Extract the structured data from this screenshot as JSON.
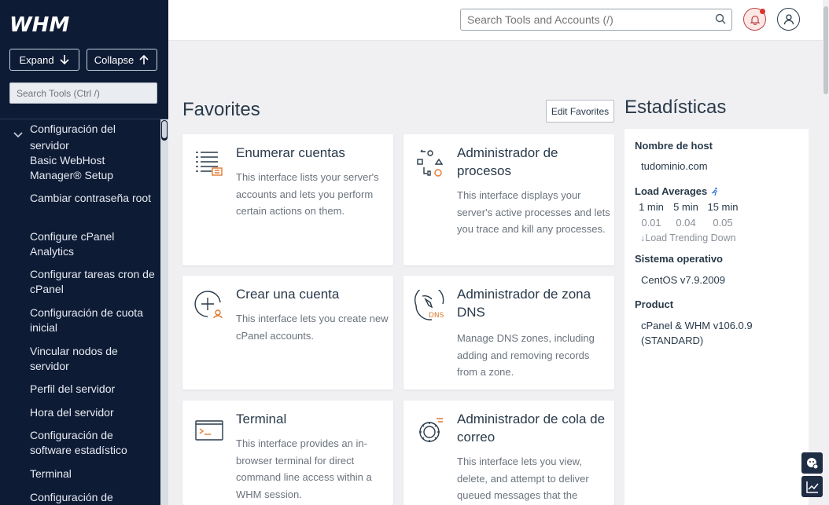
{
  "sidebar": {
    "logo_text": "WHM",
    "expand_label": "Expand",
    "collapse_label": "Collapse",
    "search_placeholder": "Search Tools (Ctrl /)",
    "section_title": "Configuración del servidor",
    "items": [
      {
        "label": "Basic WebHost Manager® Setup"
      },
      {
        "label": "Cambiar contraseña root"
      },
      {
        "label": "Configure cPanel Analytics"
      },
      {
        "label": "Configurar tareas cron de cPanel"
      },
      {
        "label": "Configuración de cuota inicial"
      },
      {
        "label": "Vincular nodos de servidor"
      },
      {
        "label": "Perfil del servidor"
      },
      {
        "label": "Hora del servidor"
      },
      {
        "label": "Configuración de software estadístico"
      },
      {
        "label": "Terminal"
      },
      {
        "label": "Configuración de"
      }
    ]
  },
  "topbar": {
    "search_placeholder": "Search Tools and Accounts (/)"
  },
  "favorites": {
    "title": "Favorites",
    "edit_label": "Edit Favorites",
    "cards": [
      {
        "title": "Enumerar cuentas",
        "desc": "This interface lists your server's accounts and lets you perform certain actions on them.",
        "icon": "list-accounts-icon"
      },
      {
        "title": "Administrador de procesos",
        "desc": "This interface displays your server's active processes and lets you trace and kill any processes.",
        "icon": "process-manager-icon"
      },
      {
        "title": "Crear una cuenta",
        "desc": "This interface lets you create new cPanel accounts.",
        "icon": "create-account-icon"
      },
      {
        "title": "Administrador de zona DNS",
        "desc": "Manage DNS zones, including adding and removing records from a zone.",
        "icon": "dns-zone-icon"
      },
      {
        "title": "Terminal",
        "desc": "This interface provides an in-browser terminal for direct command line access within a WHM session.",
        "icon": "terminal-icon"
      },
      {
        "title": "Administrador de cola de correo",
        "desc": "This interface lets you view, delete, and attempt to deliver queued messages that the",
        "icon": "mail-queue-icon"
      }
    ]
  },
  "stats": {
    "title": "Estadísticas",
    "hostname_label": "Nombre de host",
    "hostname": "tudominio.com",
    "load_label": "Load Averages",
    "load_cols": [
      "1 min",
      "5 min",
      "15 min"
    ],
    "load_values": [
      "0.01",
      "0.04",
      "0.05"
    ],
    "load_trend": "Load Trending Down",
    "os_label": "Sistema operativo",
    "os": "CentOS v7.9.2009",
    "product_label": "Product",
    "product": "cPanel & WHM v106.0.9 (STANDARD)"
  },
  "colors": {
    "sidebar_bg": "#0e1b35",
    "page_bg": "#f0f0f3",
    "text": "#293a4a",
    "notification": "#d9342b"
  }
}
